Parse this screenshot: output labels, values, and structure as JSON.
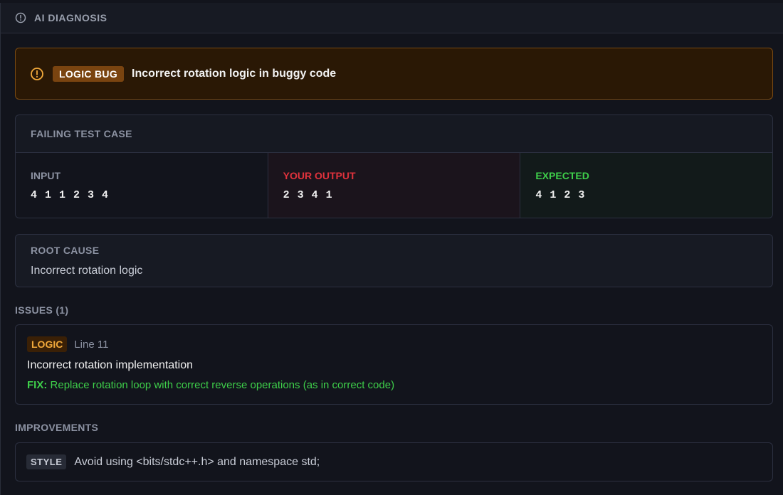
{
  "header": {
    "title": "AI DIAGNOSIS",
    "icon": "info-circle-icon"
  },
  "bug": {
    "icon": "warning-circle-icon",
    "badge": "LOGIC BUG",
    "title": "Incorrect rotation logic in buggy code",
    "accent": "#7a4410"
  },
  "test_case": {
    "title": "FAILING TEST CASE",
    "input": {
      "label": "INPUT",
      "value": "4 1 1 2 3 4"
    },
    "output": {
      "label": "YOUR OUTPUT",
      "value": "2 3 4 1",
      "color": "#e0323c"
    },
    "expected": {
      "label": "EXPECTED",
      "value": "4 1 2 3",
      "color": "#3ecf4a"
    }
  },
  "root_cause": {
    "label": "ROOT CAUSE",
    "text": "Incorrect rotation logic"
  },
  "issues": {
    "label": "ISSUES (1)",
    "items": [
      {
        "type": "LOGIC",
        "line": "Line 11",
        "title": "Incorrect rotation implementation",
        "fix_label": "FIX:",
        "fix": "Replace rotation loop with correct reverse operations (as in correct code)"
      }
    ]
  },
  "improvements": {
    "label": "IMPROVEMENTS",
    "items": [
      {
        "type": "STYLE",
        "text": "Avoid using <bits/stdc++.h> and namespace std;"
      }
    ]
  }
}
